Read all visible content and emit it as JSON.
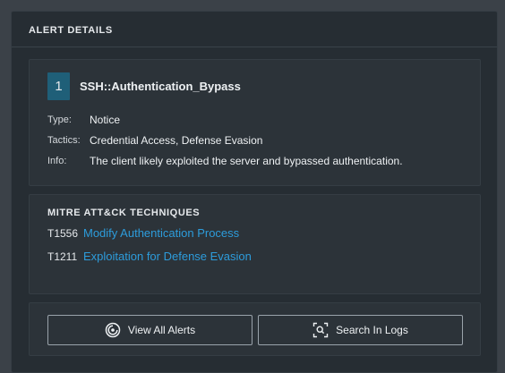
{
  "panel": {
    "title": "ALERT DETAILS"
  },
  "rule": {
    "index": "1",
    "name": "SSH::Authentication_Bypass",
    "details": [
      {
        "label": "Type:",
        "value": "Notice"
      },
      {
        "label": "Tactics:",
        "value": "Credential Access, Defense Evasion"
      },
      {
        "label": "Info:",
        "value": "The client likely exploited the server and bypassed authentication."
      }
    ]
  },
  "mitre": {
    "title": "MITRE ATT&CK TECHNIQUES",
    "techniques": [
      {
        "id": "T1556",
        "name": "Modify Authentication Process"
      },
      {
        "id": "T1211",
        "name": "Exploitation for Defense Evasion"
      }
    ]
  },
  "actions": {
    "view_alerts": {
      "label": "View All Alerts",
      "icon": "alerts-icon"
    },
    "search_logs": {
      "label": "Search In Logs",
      "icon": "search-logs-icon"
    }
  },
  "colors": {
    "accent_badge": "#1f5f78",
    "link": "#2d9cdb",
    "panel_bg": "#262d33"
  }
}
